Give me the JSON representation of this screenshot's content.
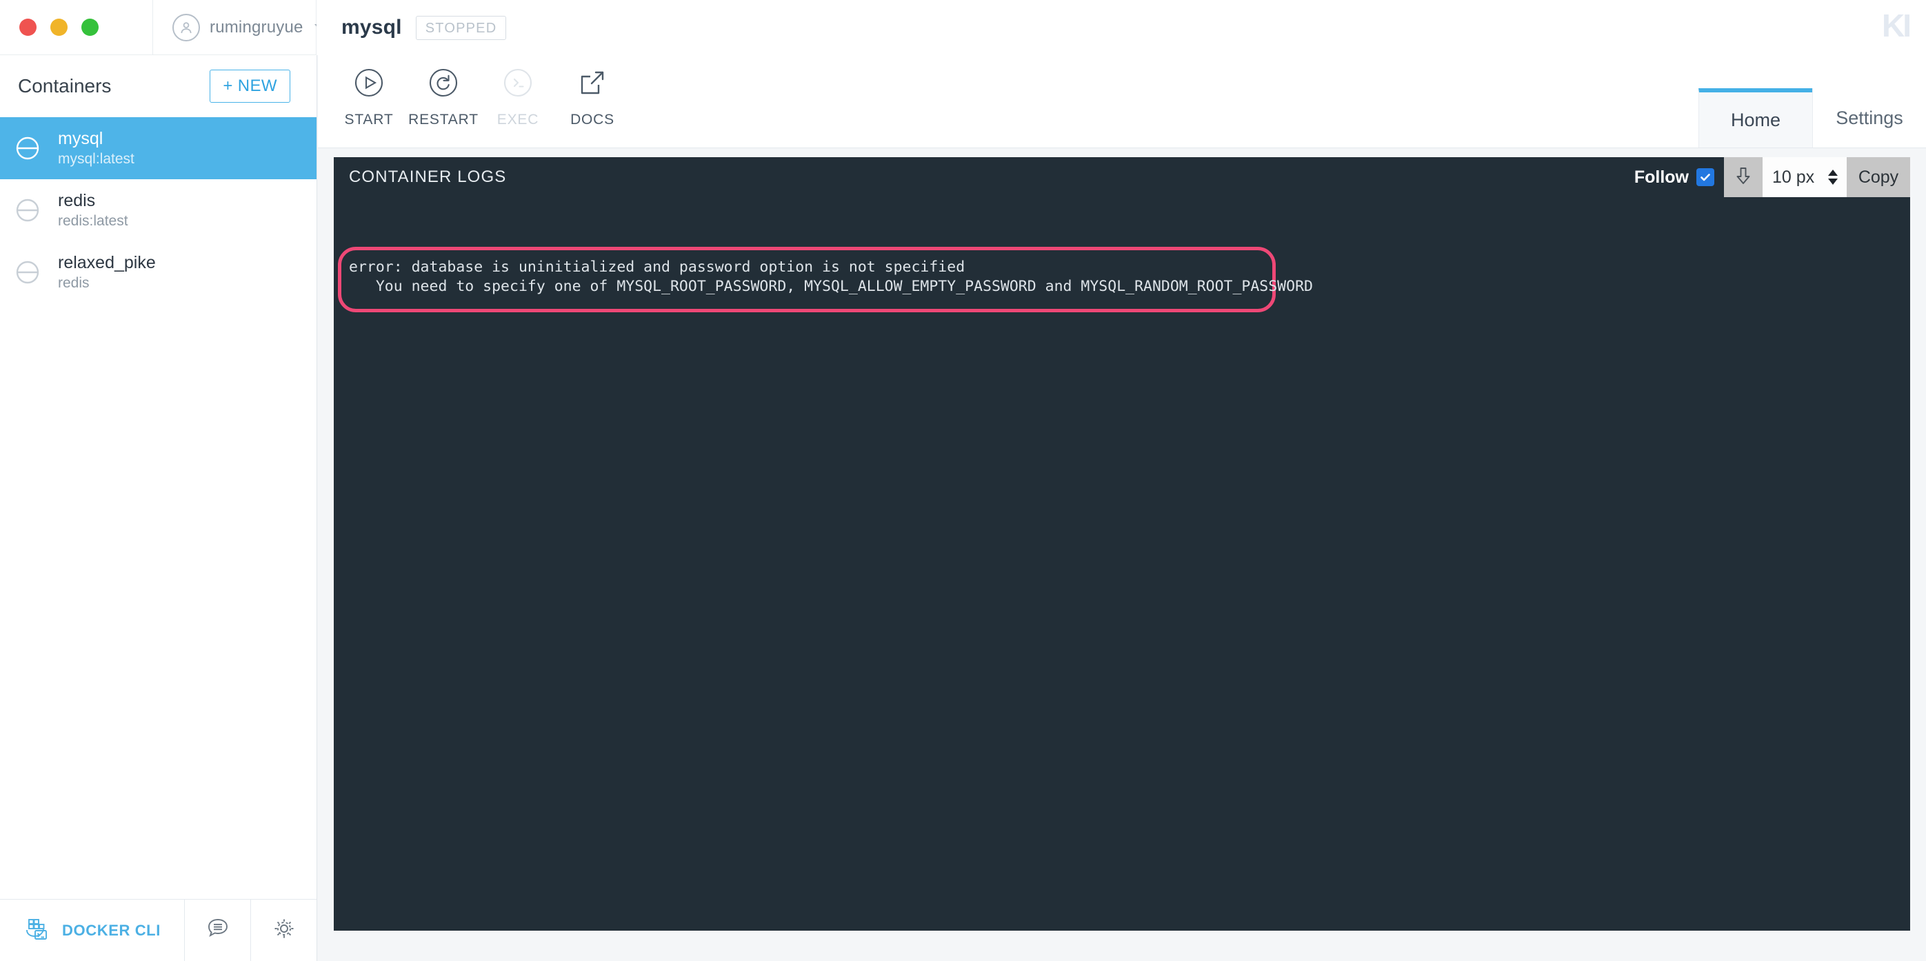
{
  "window": {
    "traffic_lights": [
      "close",
      "minimize",
      "maximize"
    ],
    "user": {
      "name": "rumingruyue",
      "avatar_icon": "user-circle-icon",
      "caret_icon": "chevron-down-icon"
    },
    "brand_logo": "KI"
  },
  "header": {
    "container_name": "mysql",
    "status_badge": "STOPPED"
  },
  "toolbar": {
    "actions": [
      {
        "label": "START",
        "icon": "play-circle-icon",
        "disabled": false
      },
      {
        "label": "RESTART",
        "icon": "restart-circle-icon",
        "disabled": false
      },
      {
        "label": "EXEC",
        "icon": "terminal-circle-icon",
        "disabled": true
      },
      {
        "label": "DOCS",
        "icon": "external-link-icon",
        "disabled": false
      }
    ],
    "tabs": [
      {
        "label": "Home",
        "active": true
      },
      {
        "label": "Settings",
        "active": false
      }
    ]
  },
  "sidebar": {
    "title": "Containers",
    "new_button": "+ NEW",
    "items": [
      {
        "name": "mysql",
        "image": "mysql:latest",
        "icon": "stopped-circle-icon",
        "active": true
      },
      {
        "name": "redis",
        "image": "redis:latest",
        "icon": "stopped-circle-icon",
        "active": false
      },
      {
        "name": "relaxed_pike",
        "image": "redis",
        "icon": "stopped-circle-icon",
        "active": false
      }
    ],
    "footer": {
      "cli_label": "DOCKER CLI",
      "cli_icon": "docker-cli-icon",
      "feedback_icon": "chat-bubble-icon",
      "settings_icon": "gear-icon"
    }
  },
  "logs": {
    "title": "CONTAINER LOGS",
    "follow_label": "Follow",
    "follow_checked": true,
    "download_icon": "download-arrow-icon",
    "font_size": "10 px",
    "copy_label": "Copy",
    "content": "error: database is uninitialized and password option is not specified\n   You need to specify one of MYSQL_ROOT_PASSWORD, MYSQL_ALLOW_EMPTY_PASSWORD and MYSQL_RANDOM_ROOT_PASSWORD",
    "highlight_color": "#ee4876",
    "panel_bg": "#222e37"
  },
  "colors": {
    "accent_blue": "#4eb4e8",
    "link_blue": "#2fa3e0",
    "highlight_pink": "#ee4876",
    "log_bg": "#222e37",
    "app_bg": "#f4f6f8"
  }
}
